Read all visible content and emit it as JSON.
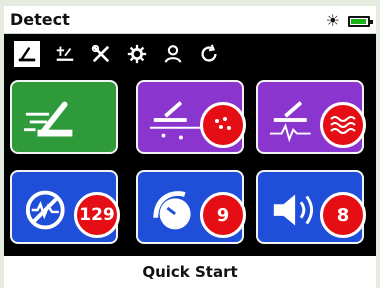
{
  "header": {
    "title": "Detect",
    "battery_level": 0.75
  },
  "tabs": [
    {
      "name": "detect-tab",
      "icon": "detect-coil-icon",
      "active": true
    },
    {
      "name": "ground-balance-tab",
      "icon": "ground-balance-icon",
      "active": false
    },
    {
      "name": "tools-tab",
      "icon": "tools-icon",
      "active": false
    },
    {
      "name": "settings-tab",
      "icon": "gear-icon",
      "active": false
    },
    {
      "name": "user-tab",
      "icon": "user-icon",
      "active": false
    },
    {
      "name": "refresh-tab",
      "icon": "refresh-icon",
      "active": false
    }
  ],
  "tiles": [
    {
      "name": "quick-start-tile",
      "color": "#2e9a3a",
      "icon": "coil-speed-icon",
      "badge": ""
    },
    {
      "name": "ground-mode-tile",
      "color": "#8b35cf",
      "icon": "ground-mineral-icon",
      "badge_icon": "dots-icon"
    },
    {
      "name": "soil-mode-tile",
      "color": "#8b35cf",
      "icon": "signal-wave-icon",
      "badge_icon": "waves-icon"
    },
    {
      "name": "noise-cancel-tile",
      "color": "#1f4fd8",
      "icon": "noise-cancel-icon",
      "badge": "129"
    },
    {
      "name": "sensitivity-tile",
      "color": "#1f4fd8",
      "icon": "sensitivity-dial-icon",
      "badge": "9"
    },
    {
      "name": "volume-tile",
      "color": "#1f4fd8",
      "icon": "speaker-icon",
      "badge": "8"
    }
  ],
  "footer": {
    "label": "Quick Start"
  }
}
